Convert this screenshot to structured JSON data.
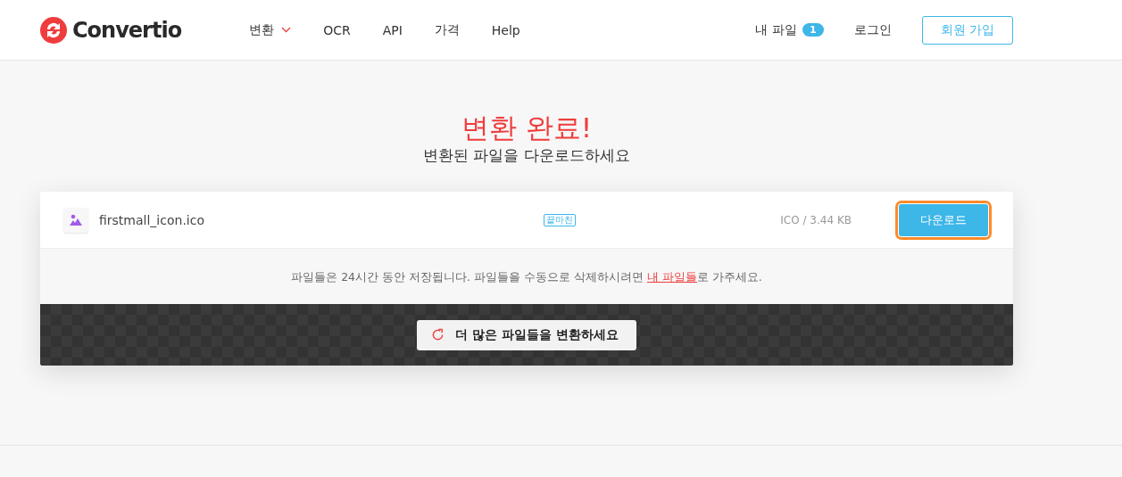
{
  "header": {
    "logo": "Convertio",
    "nav": [
      {
        "label": "변환",
        "dropdown": true
      },
      {
        "label": "OCR",
        "dropdown": false
      },
      {
        "label": "API",
        "dropdown": false
      },
      {
        "label": "가격",
        "dropdown": false
      },
      {
        "label": "Help",
        "dropdown": false
      }
    ],
    "my_files": {
      "label": "내 파일",
      "count": "1"
    },
    "login": "로그인",
    "signup": "회원 가입"
  },
  "title": "변환 완료!",
  "subtitle": "변환된 파일을 다운로드하세요",
  "files": [
    {
      "name": "firstmall_icon.ico",
      "tag": "끝마친",
      "info": "ICO / 3.44 KB",
      "button": "다운로드",
      "highlighted": true
    }
  ],
  "note": {
    "before": "파일들은 24시간 동안 저장됩니다. 파일들을 수동으로 삭제하시려면 ",
    "link": "내 파일들",
    "after": "로 가주세요."
  },
  "convert_more": "더 많은 파일들을 변환하세요"
}
